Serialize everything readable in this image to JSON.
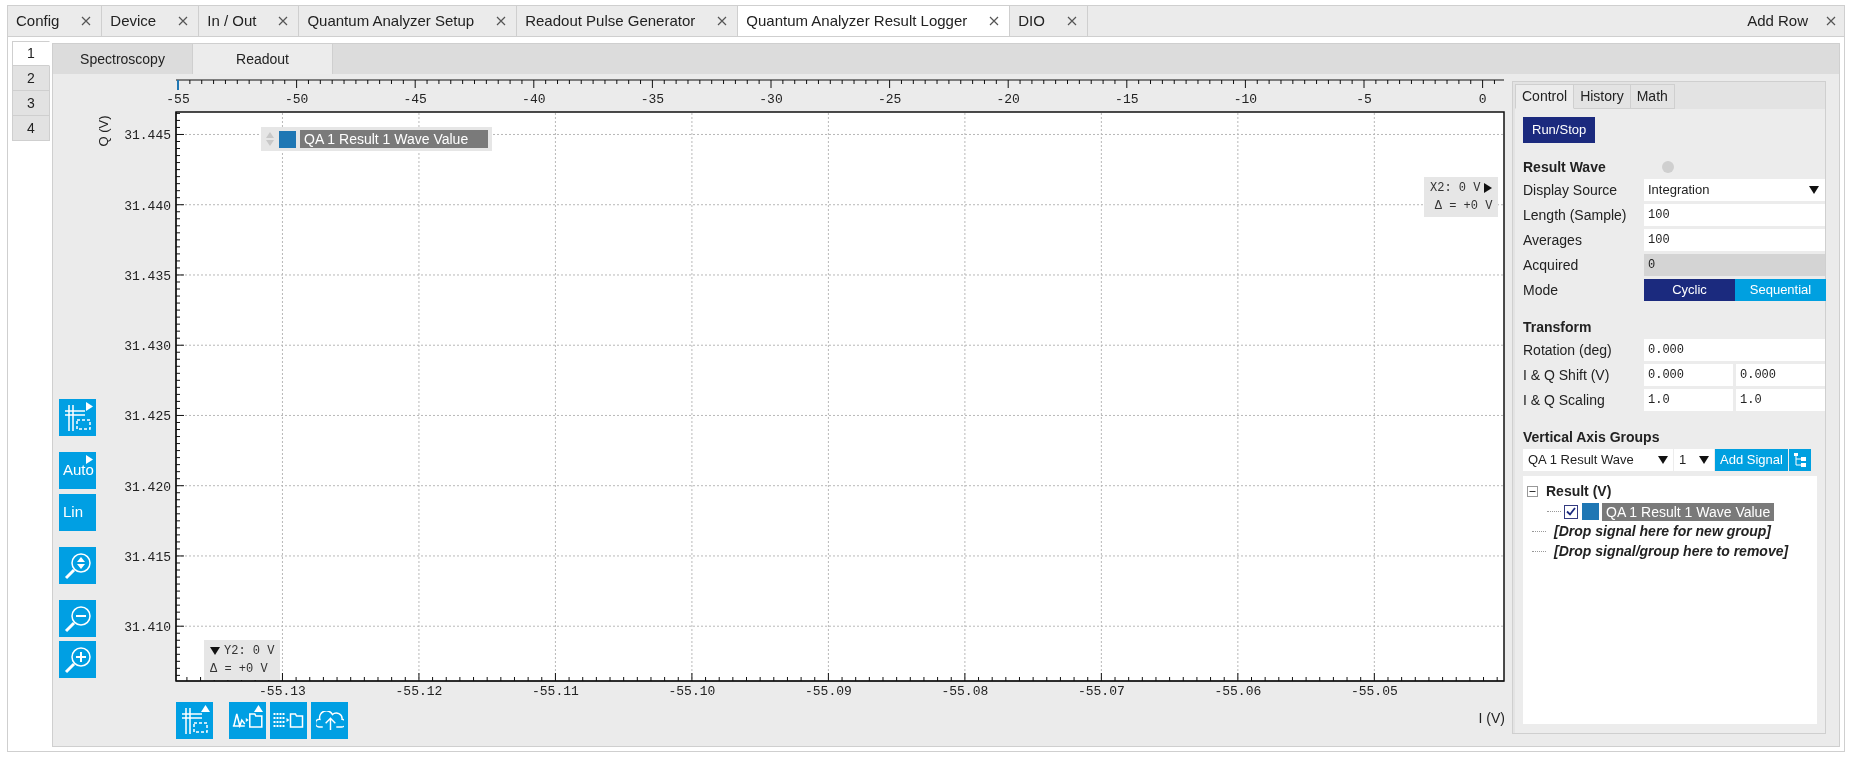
{
  "tabs": [
    {
      "label": "Config",
      "selected": false
    },
    {
      "label": "Device",
      "selected": false
    },
    {
      "label": "In / Out",
      "selected": false
    },
    {
      "label": "Quantum Analyzer Setup",
      "selected": false
    },
    {
      "label": "Readout Pulse Generator",
      "selected": false
    },
    {
      "label": "Quantum Analyzer Result Logger",
      "selected": true
    },
    {
      "label": "DIO",
      "selected": false
    }
  ],
  "add_row": {
    "label": "Add Row"
  },
  "rows": [
    {
      "label": "1",
      "selected": true
    },
    {
      "label": "2",
      "selected": false
    },
    {
      "label": "3",
      "selected": false
    },
    {
      "label": "4",
      "selected": false
    }
  ],
  "subtabs": [
    {
      "label": "Spectroscopy",
      "selected": false
    },
    {
      "label": "Readout",
      "selected": true
    }
  ],
  "plot": {
    "legend": {
      "label": "QA 1 Result 1 Wave Value",
      "color": "#1f77b4"
    },
    "cursor_x": {
      "label": "X2: 0 V",
      "delta": "Δ = +0 V"
    },
    "cursor_y": {
      "label": "Y2: 0 V",
      "delta": "Δ = +0 V"
    },
    "top_axis": {
      "ticks": [
        "-55",
        "-50",
        "-45",
        "-40",
        "-35",
        "-30",
        "-25",
        "-20",
        "-15",
        "-10",
        "-5",
        "0"
      ]
    },
    "chart_data": {
      "type": "scatter",
      "grid": true,
      "xlabel": "I (V)",
      "ylabel": "Q (V)",
      "xlim": [
        -55.1378,
        -55.0405
      ],
      "ylim": [
        31.4061,
        31.4466
      ],
      "xticks": [
        {
          "value": -55.13,
          "label": "-55.13"
        },
        {
          "value": -55.12,
          "label": "-55.12"
        },
        {
          "value": -55.11,
          "label": "-55.11"
        },
        {
          "value": -55.1,
          "label": "-55.10"
        },
        {
          "value": -55.09,
          "label": "-55.09"
        },
        {
          "value": -55.08,
          "label": "-55.08"
        },
        {
          "value": -55.07,
          "label": "-55.07"
        },
        {
          "value": -55.06,
          "label": "-55.06"
        },
        {
          "value": -55.05,
          "label": "-55.05"
        }
      ],
      "yticks": [
        {
          "value": 31.41,
          "label": "31.410"
        },
        {
          "value": 31.415,
          "label": "31.415"
        },
        {
          "value": 31.42,
          "label": "31.420"
        },
        {
          "value": 31.425,
          "label": "31.425"
        },
        {
          "value": 31.43,
          "label": "31.430"
        },
        {
          "value": 31.435,
          "label": "31.435"
        },
        {
          "value": 31.44,
          "label": "31.440"
        },
        {
          "value": 31.445,
          "label": "31.445"
        }
      ]
    },
    "side_tools": [
      {
        "kind": "grid",
        "menu": true
      },
      {
        "kind": "text",
        "label": "Auto",
        "menu": true
      },
      {
        "kind": "text",
        "label": "Lin",
        "menu": false
      },
      {
        "kind": "zoom-fit",
        "menu": false
      },
      {
        "kind": "zoom-out",
        "menu": false
      },
      {
        "kind": "zoom-in",
        "menu": false
      }
    ],
    "bottom_tools": [
      {
        "kind": "grid",
        "menu": true
      },
      {
        "kind": "wave-folder",
        "menu": true
      },
      {
        "kind": "list-folder",
        "menu": false
      },
      {
        "kind": "cloud-upload",
        "menu": false
      }
    ]
  },
  "side_panel": {
    "tabs": [
      {
        "label": "Control",
        "selected": true
      },
      {
        "label": "History",
        "selected": false
      },
      {
        "label": "Math",
        "selected": false
      }
    ],
    "run_button": "Run/Stop",
    "sections": [
      {
        "title": "Result Wave",
        "status_led": {
          "on": false
        },
        "fields": [
          {
            "kind": "select",
            "label": "Display Source",
            "value": "Integration"
          },
          {
            "kind": "input",
            "label": "Length (Sample)",
            "value": "100"
          },
          {
            "kind": "input",
            "label": "Averages",
            "value": "100"
          },
          {
            "kind": "readonly",
            "label": "Acquired",
            "value": "0"
          },
          {
            "kind": "toggle",
            "label": "Mode",
            "options": [
              {
                "label": "Cyclic",
                "selected": true
              },
              {
                "label": "Sequential",
                "selected": false
              }
            ]
          }
        ]
      },
      {
        "title": "Transform",
        "fields": [
          {
            "kind": "input",
            "label": "Rotation (deg)",
            "value": "0.000"
          },
          {
            "kind": "pair",
            "label": "I & Q Shift (V)",
            "values": [
              "0.000",
              "0.000"
            ]
          },
          {
            "kind": "pair",
            "label": "I & Q Scaling",
            "values": [
              "1.0",
              "1.0"
            ]
          }
        ]
      }
    ],
    "axis_groups": {
      "title": "Vertical Axis Groups",
      "signal_select": "QA 1 Result Wave",
      "index_select": "1",
      "add_button": "Add Signal",
      "tree": [
        {
          "label": "Result (V)",
          "expanded": true,
          "children": [
            {
              "label": "QA 1 Result 1 Wave Value",
              "checked": true,
              "color": "#1f77b4"
            }
          ]
        }
      ],
      "drop_hints": [
        "[Drop signal here for new group]",
        "[Drop signal/group here to remove]"
      ]
    }
  }
}
